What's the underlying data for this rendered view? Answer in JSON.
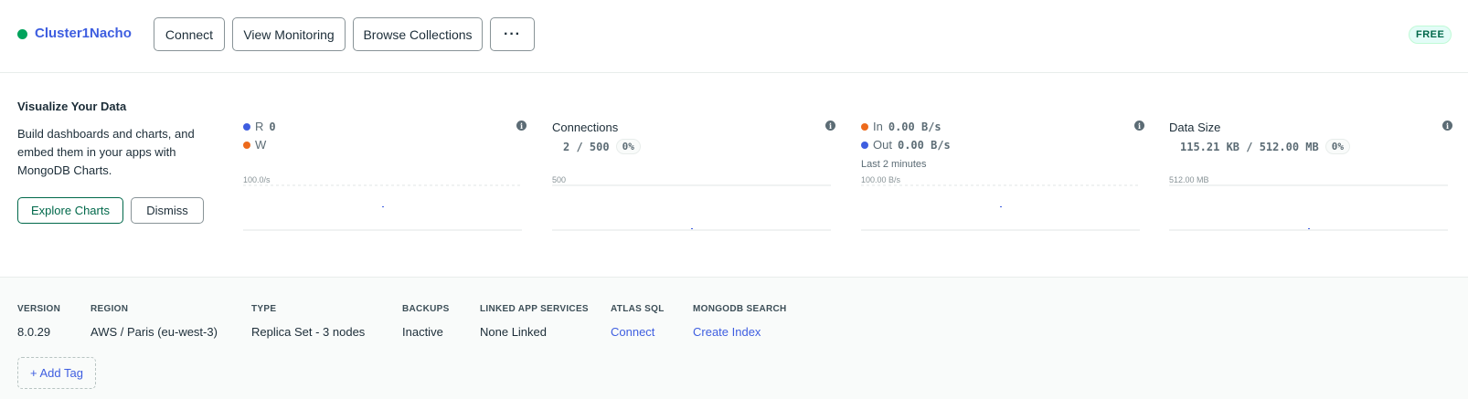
{
  "header": {
    "cluster_name": "Cluster1Nacho",
    "status_color": "#00a35c",
    "buttons": {
      "connect": "Connect",
      "view_monitoring": "View Monitoring",
      "browse_collections": "Browse Collections",
      "more": "···"
    },
    "tier_badge": "FREE"
  },
  "visualize": {
    "title": "Visualize Your Data",
    "description": "Build dashboards and charts, and embed them in your apps with MongoDB Charts.",
    "explore_label": "Explore Charts",
    "dismiss_label": "Dismiss"
  },
  "metrics": {
    "operations": {
      "read_label": "R",
      "read_value": "0",
      "write_label": "W",
      "axis_max": "100.0/s",
      "info_icon": "info-icon"
    },
    "connections": {
      "label": "Connections",
      "value": "2 / 500",
      "percent": "0%",
      "axis_max": "500"
    },
    "network": {
      "in_label": "In",
      "in_value": "0.00 B/s",
      "out_label": "Out",
      "out_value": "0.00 B/s",
      "window": "Last 2 minutes",
      "axis_max": "100.00 B/s"
    },
    "data_size": {
      "label": "Data Size",
      "value": "115.21 KB / 512.00 MB",
      "percent": "0%",
      "axis_max": "512.00 MB"
    }
  },
  "details": {
    "version": {
      "label": "VERSION",
      "value": "8.0.29"
    },
    "region": {
      "label": "REGION",
      "value": "AWS / Paris (eu-west-3)"
    },
    "type": {
      "label": "TYPE",
      "value": "Replica Set - 3 nodes"
    },
    "backups": {
      "label": "BACKUPS",
      "value": "Inactive"
    },
    "linked_app_services": {
      "label": "LINKED APP SERVICES",
      "value": "None Linked"
    },
    "atlas_sql": {
      "label": "ATLAS SQL",
      "value": "Connect"
    },
    "mongodb_search": {
      "label": "MONGODB SEARCH",
      "value": "Create Index"
    }
  },
  "add_tag_label": "+ Add Tag",
  "colors": {
    "brand_blue": "#3e5ee0",
    "brand_green": "#00684a",
    "series_orange": "#ed6a1c"
  }
}
